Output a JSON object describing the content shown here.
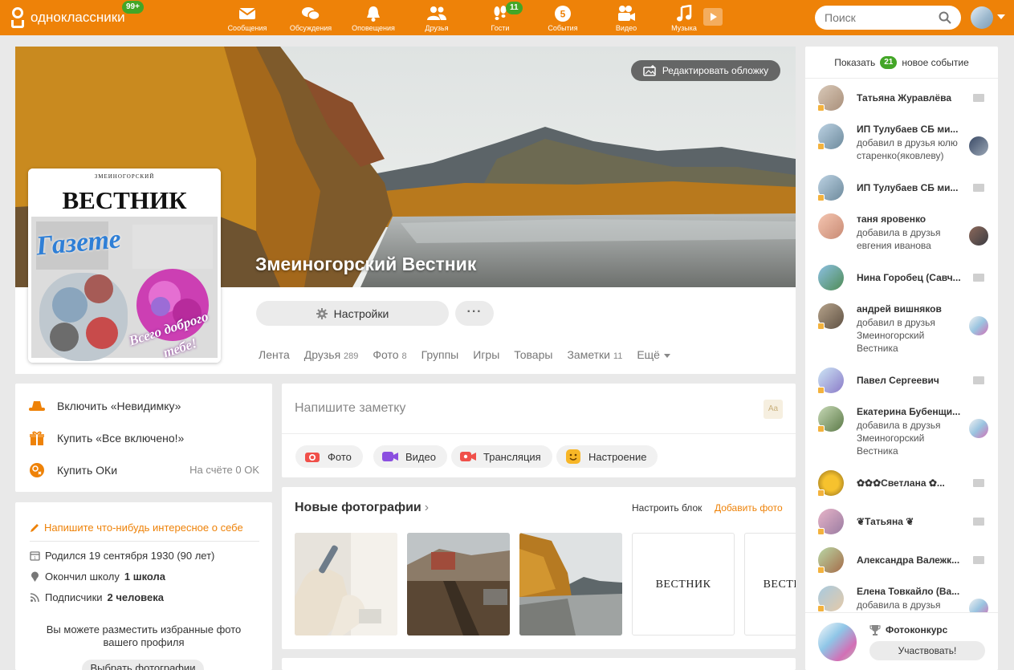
{
  "header": {
    "logo_text": "одноклассники",
    "logo_badge": "99+",
    "nav": [
      {
        "label": "Сообщения",
        "icon": "envelope-icon",
        "badge": ""
      },
      {
        "label": "Обсуждения",
        "icon": "chat-bubbles-icon",
        "badge": ""
      },
      {
        "label": "Оповещения",
        "icon": "bell-icon",
        "badge": ""
      },
      {
        "label": "Друзья",
        "icon": "friends-icon",
        "badge": ""
      },
      {
        "label": "Гости",
        "icon": "footprints-icon",
        "badge": "11"
      },
      {
        "label": "События",
        "icon": "events-icon",
        "badge": "5"
      },
      {
        "label": "Видео",
        "icon": "video-camera-icon",
        "badge": ""
      },
      {
        "label": "Музыка",
        "icon": "music-note-icon",
        "badge": ""
      }
    ],
    "search_placeholder": "Поиск",
    "accent_color": "#ee8208"
  },
  "profile": {
    "name": "Змеиногорский Вестник",
    "edit_cover": "Редактировать обложку",
    "settings_label": "Настройки",
    "more_label": "···",
    "avatar_text": {
      "masthead_small": "ЗМЕИНОГОРСКИЙ",
      "masthead": "ВЕСТНИК",
      "line1": "Газете",
      "line2": "Всего доброго",
      "line3": "тебе!"
    },
    "tabs": [
      {
        "label": "Лента",
        "count": ""
      },
      {
        "label": "Друзья",
        "count": "289"
      },
      {
        "label": "Фото",
        "count": "8"
      },
      {
        "label": "Группы",
        "count": ""
      },
      {
        "label": "Игры",
        "count": ""
      },
      {
        "label": "Товары",
        "count": ""
      },
      {
        "label": "Заметки",
        "count": "11"
      },
      {
        "label": "Ещё",
        "count": ""
      }
    ]
  },
  "left_options": {
    "invisible": "Включить «Невидимку»",
    "all_inclusive": "Купить «Все включено!»",
    "buy_ok": "Купить ОКи",
    "balance": "На счёте 0 OK"
  },
  "about": {
    "write_prompt": "Напишите что-нибудь интересное о себе",
    "born": "Родился 19 сентября 1930 (90 лет)",
    "school_prefix": "Окончил школу",
    "school": "1 школа",
    "followers_prefix": "Подписчики",
    "followers": "2 человека",
    "fav_text": "Вы можете разместить избранные фото вашего профиля",
    "fav_button": "Выбрать фотографии"
  },
  "post": {
    "placeholder": "Напишите заметку",
    "aa": "Aa",
    "chips": [
      {
        "label": "Фото",
        "icon": "camera-icon"
      },
      {
        "label": "Видео",
        "icon": "video-icon"
      },
      {
        "label": "Трансляция",
        "icon": "broadcast-icon"
      },
      {
        "label": "Настроение",
        "icon": "smile-icon"
      }
    ]
  },
  "photos": {
    "title": "Новые фотографии",
    "chevron": "›",
    "configure": "Настроить блок",
    "add": "Добавить фото",
    "vestnik_label": "ВЕСТНИК"
  },
  "events": {
    "show_prefix": "Показать",
    "count": "21",
    "show_suffix": "новое событие",
    "friends": [
      {
        "name": "Татьяна Журавлёва",
        "sub": ""
      },
      {
        "name": "ИП Тулубаев СБ ми...",
        "sub": "добавил в друзья юлю старенко(яковлеву)"
      },
      {
        "name": "ИП Тулубаев СБ ми...",
        "sub": ""
      },
      {
        "name": "таня яровенко",
        "sub": "добавила в друзья евгения иванова"
      },
      {
        "name": "Нина Горобец (Савч...",
        "sub": ""
      },
      {
        "name": "андрей вишняков",
        "sub": "добавил в друзья Змеиногорский Вестника"
      },
      {
        "name": "Павел Сергеевич",
        "sub": ""
      },
      {
        "name": "Екатерина Бубенщи...",
        "sub": "добавила в друзья Змеиногорский Вестника"
      },
      {
        "name": "✿✿✿Светлана ✿...",
        "sub": ""
      },
      {
        "name": "❦Татьяна ❦",
        "sub": ""
      },
      {
        "name": "Александра Валежк...",
        "sub": ""
      },
      {
        "name": "Елена Товкайло (Ва...",
        "sub": "добавила в друзья"
      }
    ],
    "contest_title": "Фотоконкурс",
    "contest_button": "Участвовать!"
  }
}
